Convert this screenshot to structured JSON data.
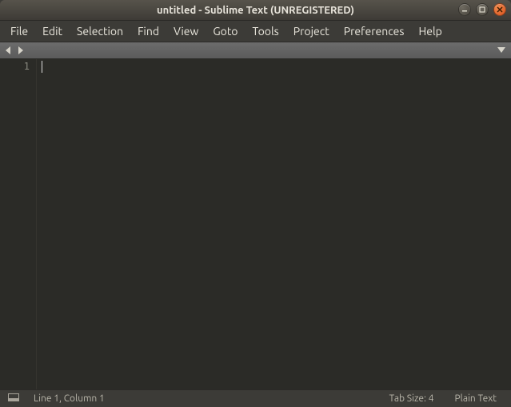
{
  "titlebar": {
    "title": "untitled - Sublime Text (UNREGISTERED)"
  },
  "menubar": {
    "items": [
      {
        "label": "File"
      },
      {
        "label": "Edit"
      },
      {
        "label": "Selection"
      },
      {
        "label": "Find"
      },
      {
        "label": "View"
      },
      {
        "label": "Goto"
      },
      {
        "label": "Tools"
      },
      {
        "label": "Project"
      },
      {
        "label": "Preferences"
      },
      {
        "label": "Help"
      }
    ]
  },
  "editor": {
    "line_numbers": [
      "1"
    ],
    "content": ""
  },
  "statusbar": {
    "position": "Line 1, Column 1",
    "tab_size": "Tab Size: 4",
    "syntax": "Plain Text"
  }
}
